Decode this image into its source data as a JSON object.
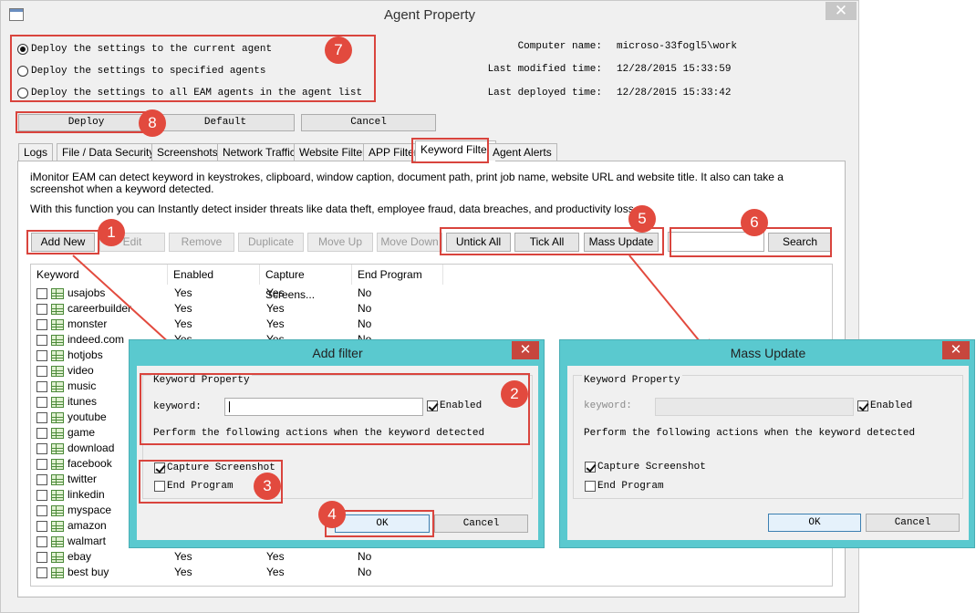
{
  "window": {
    "title": "Agent Property",
    "close_glyph": "✕"
  },
  "deploy_options": [
    {
      "label": "Deploy the settings to the current agent",
      "checked": true
    },
    {
      "label": "Deploy the settings to specified agents",
      "checked": false
    },
    {
      "label": "Deploy the settings to all EAM agents in the agent list",
      "checked": false
    }
  ],
  "info": [
    {
      "label": "Computer name:",
      "value": "microso-33fogl5\\work"
    },
    {
      "label": "Last modified time:",
      "value": "12/28/2015 15:33:59"
    },
    {
      "label": "Last deployed time:",
      "value": "12/28/2015 15:33:42"
    }
  ],
  "actions": {
    "deploy": "Deploy",
    "default": "Default",
    "cancel": "Cancel"
  },
  "tabs": [
    "Logs",
    "File / Data Security",
    "Screenshots",
    "Network Traffic",
    "Website Filter",
    "APP Filter",
    "Keyword Filter",
    "Agent Alerts"
  ],
  "active_tab": "Keyword Filter",
  "description": {
    "line1": "iMonitor EAM can detect keyword in keystrokes, clipboard, window caption, document path, print job name, website URL and website title. It also can take a screenshot when a keyword detected.",
    "line2": "With this function you can Instantly detect insider threats like data theft, employee fraud, data breaches, and productivity loss."
  },
  "toolbar": {
    "add_new": "Add New",
    "edit": "Edit",
    "remove": "Remove",
    "duplicate": "Duplicate",
    "move_up": "Move Up",
    "move_down": "Move Down",
    "untick_all": "Untick All",
    "tick_all": "Tick All",
    "mass_update": "Mass Update",
    "search_value": "",
    "search": "Search"
  },
  "table": {
    "columns": [
      "Keyword",
      "Enabled",
      "Capture Screens...",
      "End Program"
    ],
    "rows": [
      {
        "keyword": "usajobs",
        "enabled": "Yes",
        "capture": "Yes",
        "end": "No"
      },
      {
        "keyword": "careerbuilder",
        "enabled": "Yes",
        "capture": "Yes",
        "end": "No"
      },
      {
        "keyword": "monster",
        "enabled": "Yes",
        "capture": "Yes",
        "end": "No"
      },
      {
        "keyword": "indeed.com",
        "enabled": "Yes",
        "capture": "Yes",
        "end": "No"
      },
      {
        "keyword": "hotjobs",
        "enabled": "",
        "capture": "",
        "end": ""
      },
      {
        "keyword": "video",
        "enabled": "",
        "capture": "",
        "end": ""
      },
      {
        "keyword": "music",
        "enabled": "",
        "capture": "",
        "end": ""
      },
      {
        "keyword": "itunes",
        "enabled": "",
        "capture": "",
        "end": ""
      },
      {
        "keyword": "youtube",
        "enabled": "",
        "capture": "",
        "end": ""
      },
      {
        "keyword": "game",
        "enabled": "",
        "capture": "",
        "end": ""
      },
      {
        "keyword": "download",
        "enabled": "",
        "capture": "",
        "end": ""
      },
      {
        "keyword": "facebook",
        "enabled": "",
        "capture": "",
        "end": ""
      },
      {
        "keyword": "twitter",
        "enabled": "",
        "capture": "",
        "end": ""
      },
      {
        "keyword": "linkedin",
        "enabled": "",
        "capture": "",
        "end": ""
      },
      {
        "keyword": "myspace",
        "enabled": "",
        "capture": "",
        "end": ""
      },
      {
        "keyword": "amazon",
        "enabled": "",
        "capture": "",
        "end": ""
      },
      {
        "keyword": "walmart",
        "enabled": "",
        "capture": "",
        "end": ""
      },
      {
        "keyword": "ebay",
        "enabled": "Yes",
        "capture": "Yes",
        "end": "No"
      },
      {
        "keyword": "best buy",
        "enabled": "Yes",
        "capture": "Yes",
        "end": "No"
      }
    ]
  },
  "add_filter_dialog": {
    "title": "Add filter",
    "group_title": "Keyword Property",
    "keyword_label": "keyword:",
    "keyword_value": "",
    "enabled_label": "Enabled",
    "enabled_checked": true,
    "actions_text": "Perform the following actions when the keyword detected",
    "capture_label": "Capture Screenshot",
    "capture_checked": true,
    "end_label": "End Program",
    "end_checked": false,
    "ok": "OK",
    "cancel": "Cancel"
  },
  "mass_update_dialog": {
    "title": "Mass Update",
    "group_title": "Keyword Property",
    "keyword_label": "keyword:",
    "enabled_label": "Enabled",
    "enabled_checked": true,
    "actions_text": "Perform the following actions when the keyword detected",
    "capture_label": "Capture Screenshot",
    "capture_checked": true,
    "end_label": "End Program",
    "end_checked": false,
    "ok": "OK",
    "cancel": "Cancel"
  },
  "callouts": {
    "c1": "1",
    "c2": "2",
    "c3": "3",
    "c4": "4",
    "c5": "5",
    "c6": "6",
    "c7": "7",
    "c8": "8"
  },
  "colors": {
    "callout": "#e24a3e",
    "dialog_frame": "#5ac9cf",
    "window_bg": "#f0f0f0"
  }
}
